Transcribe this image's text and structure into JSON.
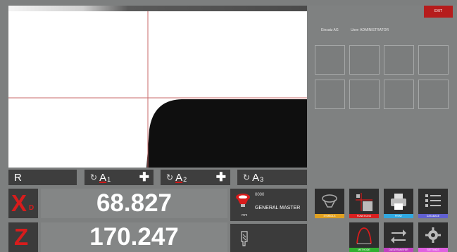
{
  "header": {
    "exit_label": "EXIT",
    "user_info": {
      "left": "Einsatz AG",
      "right": "User: ADMINISTRATOR"
    }
  },
  "params": [
    {
      "label": "R"
    },
    {
      "letter": "A",
      "index": "1"
    },
    {
      "letter": "A",
      "index": "2"
    },
    {
      "letter": "A",
      "index": "3"
    }
  ],
  "readouts": {
    "x": {
      "letter": "X",
      "subscript": "D",
      "value": "68.827"
    },
    "z": {
      "letter": "Z",
      "subscript": "",
      "value": "170.247"
    }
  },
  "master": {
    "code": "0000",
    "name": "GENERAL MASTER",
    "unit": "mm"
  },
  "function_buttons": [
    {
      "label": "SYMBOLS",
      "color": "#e0a020",
      "icon": "master-icon"
    },
    {
      "label": "FUNKTIONS",
      "color": "#d82020",
      "icon": "crosshair-tool-icon"
    },
    {
      "label": "PRINT",
      "color": "#30a8e0",
      "icon": "printer-icon"
    },
    {
      "label": "DATABASE",
      "color": "#6060d0",
      "icon": "list-icon"
    },
    {
      "label": "METHODE",
      "color": "#30b030",
      "icon": "curve-icon"
    },
    {
      "label": "DATATRANSFER",
      "color": "#c040c0",
      "icon": "transfer-arrows-icon"
    },
    {
      "label": "SETTINGS",
      "color": "#e060e0",
      "icon": "gear-icon"
    }
  ],
  "colors": {
    "accent_red": "#d81c1c",
    "exit_red": "#b61c1c",
    "crosshair": "#c86a6a"
  }
}
